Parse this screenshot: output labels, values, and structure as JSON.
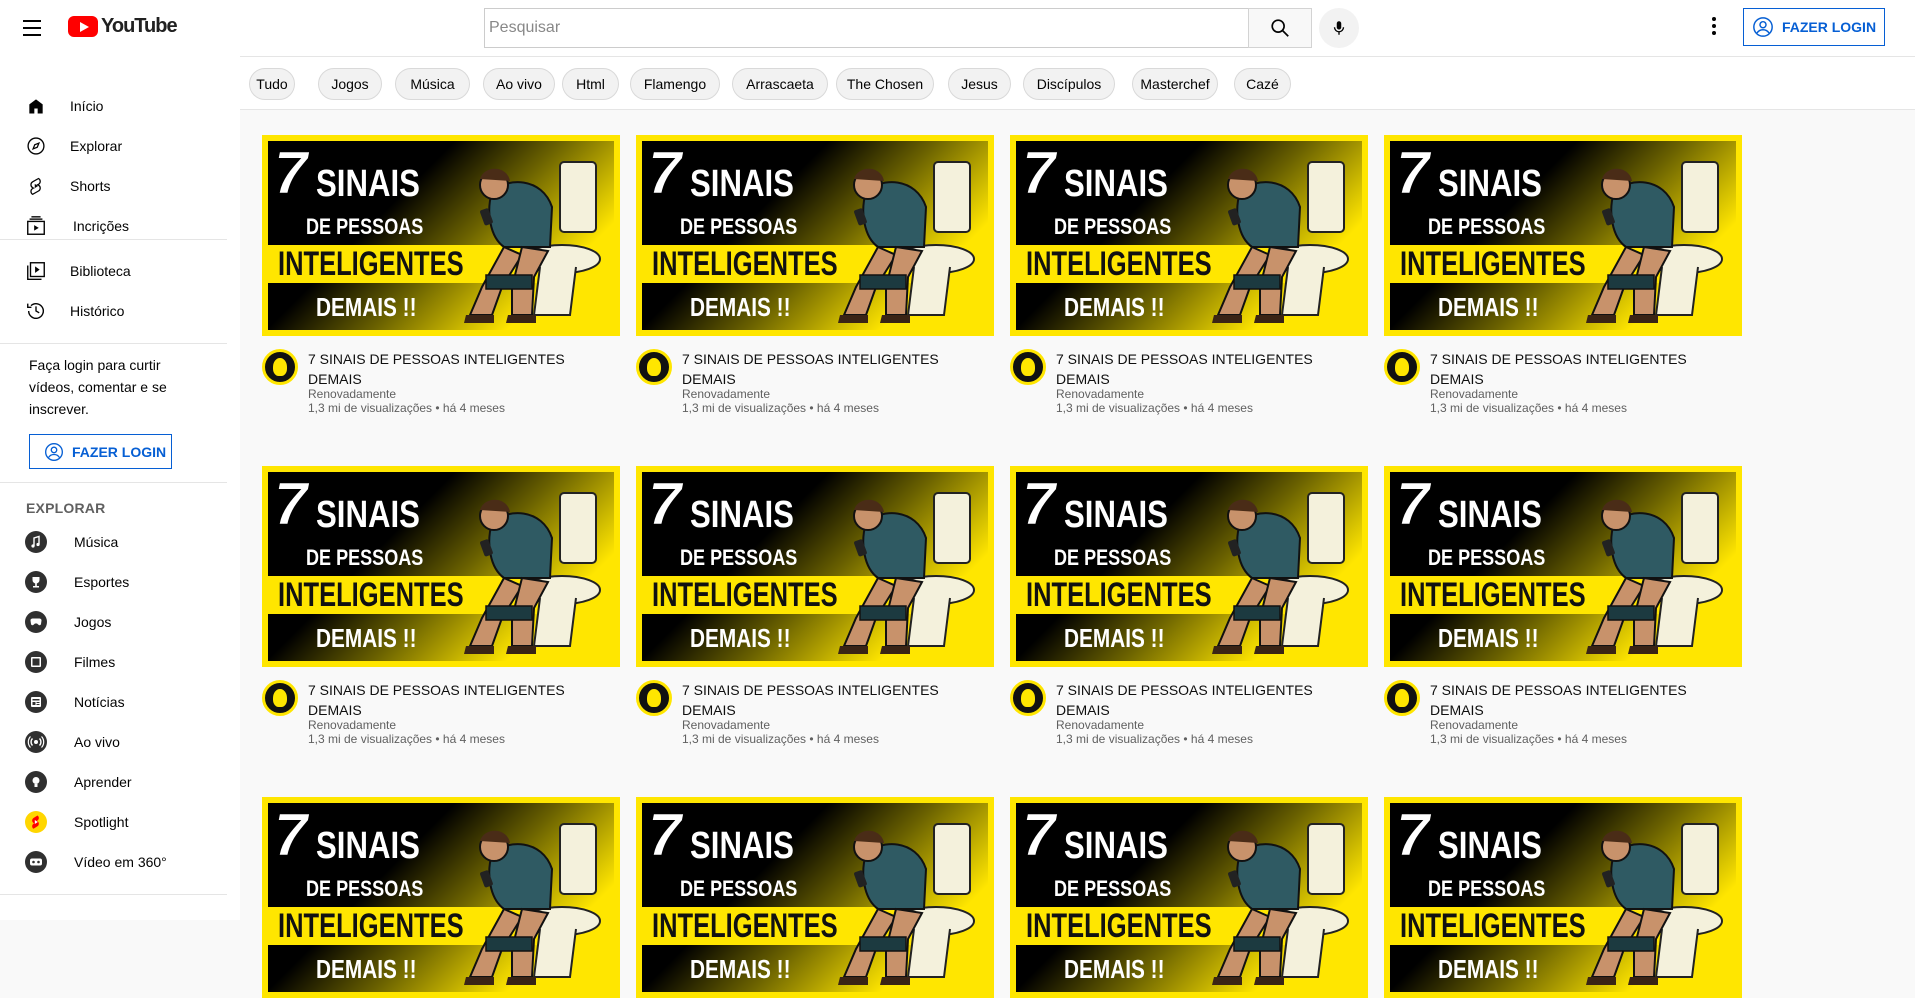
{
  "header": {
    "logo_text": "YouTube",
    "search_placeholder": "Pesquisar",
    "login_label": "FAZER LOGIN"
  },
  "sidebar": {
    "main": [
      {
        "label": "Início",
        "icon": "home-icon"
      },
      {
        "label": "Explorar",
        "icon": "compass-icon"
      },
      {
        "label": "Shorts",
        "icon": "shorts-icon"
      },
      {
        "label": "Incrições",
        "icon": "subscriptions-icon"
      }
    ],
    "library": [
      {
        "label": "Biblioteca",
        "icon": "library-icon"
      },
      {
        "label": "Histórico",
        "icon": "history-icon"
      }
    ],
    "login_prompt": "Faça login para curtir vídeos, comentar e se inscrever.",
    "login_label": "FAZER LOGIN",
    "explore_heading": "EXPLORAR",
    "explore": [
      {
        "label": "Música",
        "icon": "music-icon"
      },
      {
        "label": "Esportes",
        "icon": "trophy-icon"
      },
      {
        "label": "Jogos",
        "icon": "gaming-icon"
      },
      {
        "label": "Filmes",
        "icon": "movies-icon"
      },
      {
        "label": "Notícias",
        "icon": "news-icon"
      },
      {
        "label": "Ao vivo",
        "icon": "live-icon"
      },
      {
        "label": "Aprender",
        "icon": "lightbulb-icon"
      },
      {
        "label": "Spotlight",
        "icon": "spotlight-icon"
      },
      {
        "label": "Vídeo em 360°",
        "icon": "vr-icon"
      }
    ]
  },
  "chips": [
    "Tudo",
    "Jogos",
    "Música",
    "Ao vivo",
    "Html",
    "Flamengo",
    "Arrascaeta",
    "The Chosen",
    "Jesus",
    "Discípulos",
    "Masterchef",
    "Cazé"
  ],
  "thumbnail_text": {
    "seven": "7",
    "line1": "SINAIS",
    "line2": "DE PESSOAS",
    "line3": "INTELIGENTES",
    "line4": "DEMAIS !!"
  },
  "videos": [
    {
      "title": "7 SINAIS DE PESSOAS INTELIGENTES DEMAIS",
      "channel": "Renovadamente",
      "stats": "1,3 mi de visualizações • há 4 meses"
    },
    {
      "title": "7 SINAIS DE PESSOAS INTELIGENTES DEMAIS",
      "channel": "Renovadamente",
      "stats": "1,3 mi de visualizações • há 4 meses"
    },
    {
      "title": "7 SINAIS DE PESSOAS INTELIGENTES DEMAIS",
      "channel": "Renovadamente",
      "stats": "1,3 mi de visualizações • há 4 meses"
    },
    {
      "title": "7 SINAIS DE PESSOAS INTELIGENTES DEMAIS",
      "channel": "Renovadamente",
      "stats": "1,3 mi de visualizações • há 4 meses"
    },
    {
      "title": "7 SINAIS DE PESSOAS INTELIGENTES DEMAIS",
      "channel": "Renovadamente",
      "stats": "1,3 mi de visualizações • há 4 meses"
    },
    {
      "title": "7 SINAIS DE PESSOAS INTELIGENTES DEMAIS",
      "channel": "Renovadamente",
      "stats": "1,3 mi de visualizações • há 4 meses"
    },
    {
      "title": "7 SINAIS DE PESSOAS INTELIGENTES DEMAIS",
      "channel": "Renovadamente",
      "stats": "1,3 mi de visualizações • há 4 meses"
    },
    {
      "title": "7 SINAIS DE PESSOAS INTELIGENTES DEMAIS",
      "channel": "Renovadamente",
      "stats": "1,3 mi de visualizações • há 4 meses"
    },
    {
      "title": "",
      "channel": "",
      "stats": ""
    },
    {
      "title": "",
      "channel": "",
      "stats": ""
    },
    {
      "title": "",
      "channel": "",
      "stats": ""
    },
    {
      "title": "",
      "channel": "",
      "stats": ""
    }
  ],
  "colors": {
    "accent": "#065fd4",
    "brand": "#ff0000",
    "thumb_yellow": "#ffe600"
  }
}
